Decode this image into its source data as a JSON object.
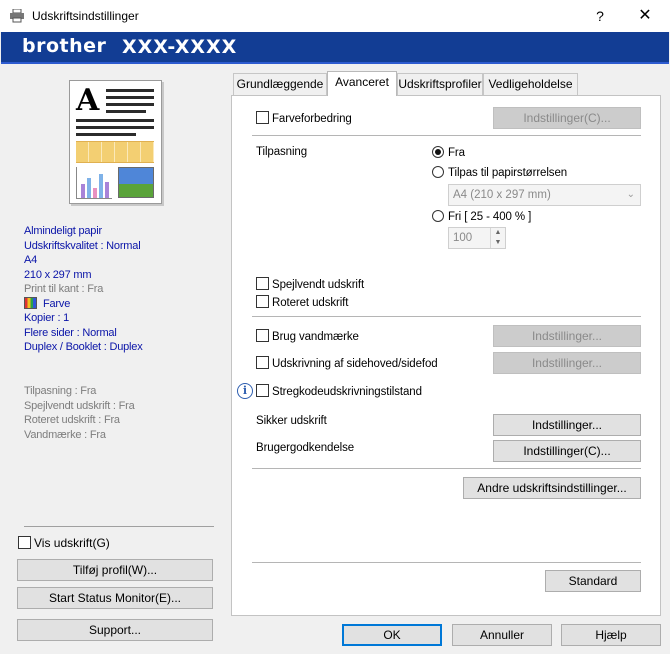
{
  "window": {
    "title": "Udskriftsindstillinger",
    "help": "?",
    "close": "✕"
  },
  "banner": {
    "logo": "brother",
    "model": "XXX-XXXX"
  },
  "summary": {
    "media": "Almindeligt papir",
    "quality": "Udskriftskvalitet : Normal",
    "paper": "A4",
    "paper_size": "210 x 297 mm",
    "borderless": "Print til kant : Fra",
    "color": "Farve",
    "copies": "Kopier : 1",
    "multi_page": "Flere sider : Normal",
    "duplex": "Duplex / Booklet : Duplex",
    "scaling": "Tilpasning : Fra",
    "mirror": "Spejlvendt udskrift : Fra",
    "rotated": "Roteret udskrift : Fra",
    "watermark": "Vandmærke : Fra"
  },
  "left_controls": {
    "show_print": "Vis udskrift(G)",
    "add_profile": "Tilføj profil(W)...",
    "status_monitor": "Start Status Monitor(E)...",
    "support": "Support..."
  },
  "tabs": [
    "Grundlæggende",
    "Avanceret",
    "Udskriftsprofiler",
    "Vedligeholdelse"
  ],
  "advanced": {
    "color_enhance": "Farveforbedring",
    "color_enhance_settings": "Indstillinger(C)...",
    "scaling_label": "Tilpasning",
    "scaling_off": "Fra",
    "scaling_fit": "Tilpas til papirstørrelsen",
    "fit_paper_value": "A4 (210 x 297 mm)",
    "scaling_free": "Fri [ 25 - 400 % ]",
    "free_value": "100",
    "mirror": "Spejlvendt udskrift",
    "rotated": "Roteret udskrift",
    "watermark": "Brug vandmærke",
    "watermark_settings": "Indstillinger...",
    "header_footer": "Udskrivning af sidehoved/sidefod",
    "header_footer_settings": "Indstillinger...",
    "barcode": "Stregkodeudskrivningstilstand",
    "secure_print": "Sikker udskrift",
    "secure_print_settings": "Indstillinger...",
    "user_auth": "Brugergodkendelse",
    "user_auth_settings": "Indstillinger(C)...",
    "other_settings": "Andre udskriftsindstillinger...",
    "default": "Standard"
  },
  "footer": {
    "ok": "OK",
    "cancel": "Annuller",
    "help": "Hjælp"
  }
}
